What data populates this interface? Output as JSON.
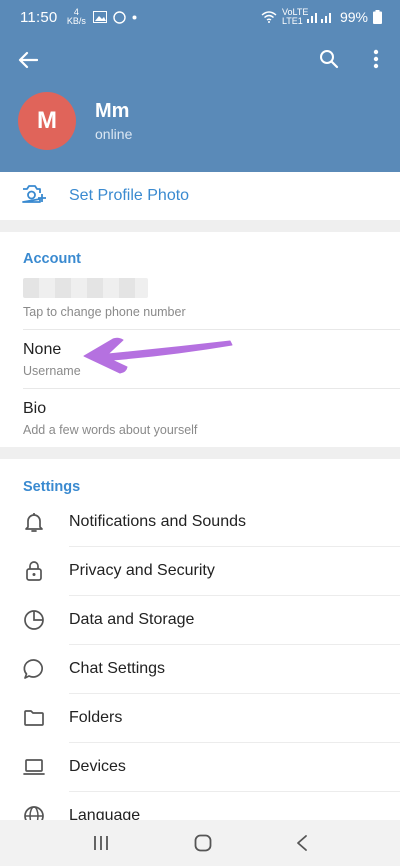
{
  "status_bar": {
    "time": "11:50",
    "small_indicator": "4 KB/s",
    "network_label": "VoLTE LTE1",
    "battery": "99%"
  },
  "header": {
    "back_icon": "arrow-left-icon",
    "search_icon": "search-icon",
    "more_icon": "more-vert-icon",
    "avatar_initial": "M",
    "name": "Mm",
    "status": "online",
    "colors": {
      "header_bg": "#5a8ab8",
      "avatar_bg": "#e0645a"
    }
  },
  "set_photo": {
    "label": "Set Profile Photo",
    "icon": "camera-add-icon"
  },
  "account": {
    "title": "Account",
    "phone_hint": "Tap to change phone number",
    "username_value": "None",
    "username_label": "Username",
    "bio_label": "Bio",
    "bio_hint": "Add a few words about yourself"
  },
  "settings": {
    "title": "Settings",
    "items": [
      {
        "label": "Notifications and Sounds",
        "icon": "bell-icon"
      },
      {
        "label": "Privacy and Security",
        "icon": "lock-icon"
      },
      {
        "label": "Data and Storage",
        "icon": "pie-chart-icon"
      },
      {
        "label": "Chat Settings",
        "icon": "chat-bubble-icon"
      },
      {
        "label": "Folders",
        "icon": "folder-icon"
      },
      {
        "label": "Devices",
        "icon": "laptop-icon"
      },
      {
        "label": "Language",
        "icon": "globe-icon"
      }
    ]
  },
  "nav_bar": {
    "recents_icon": "recents-icon",
    "home_icon": "home-icon",
    "back_icon": "nav-back-icon"
  },
  "accent_color": "#3a8ad0",
  "annotation_arrow_color": "#b571e0"
}
